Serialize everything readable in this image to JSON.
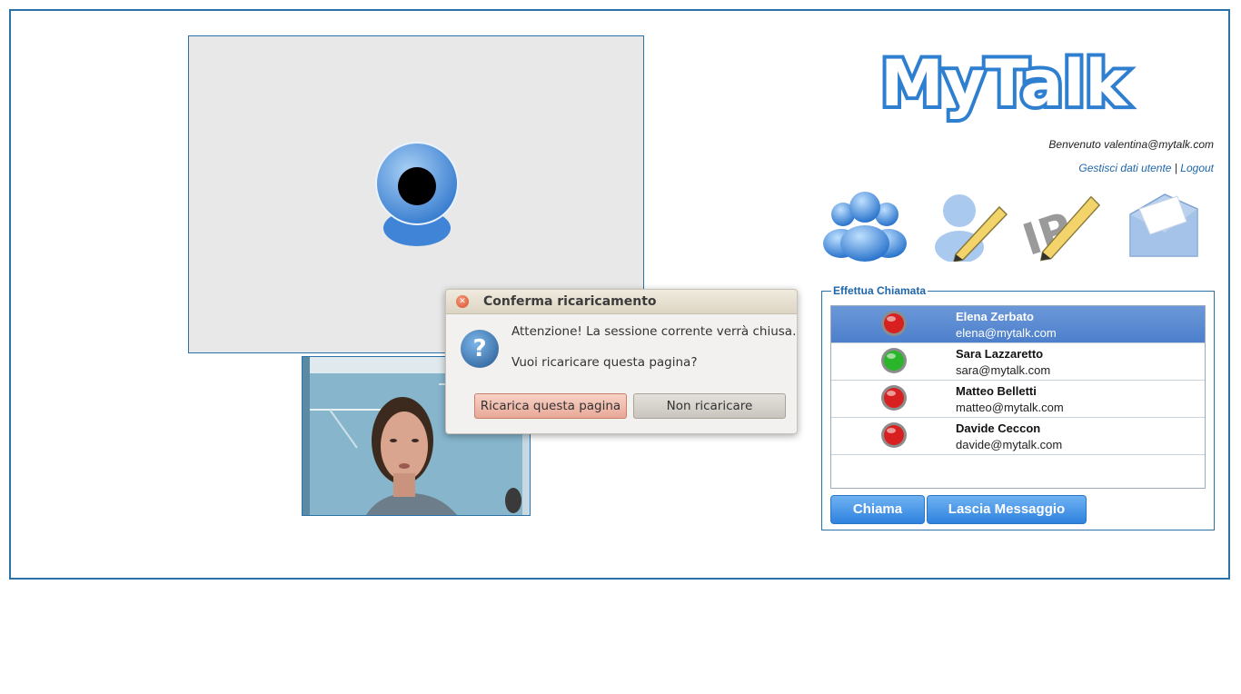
{
  "app": {
    "logo_text": "MyTalk",
    "welcome_text": "Benvenuto valentina@mytalk.com",
    "manage_user_link": "Gestisci dati utente",
    "separator": "|",
    "logout_link": "Logout"
  },
  "toolbar": {
    "icons": [
      "contacts-icon",
      "edit-user-icon",
      "edit-ip-icon",
      "messages-icon"
    ]
  },
  "call_panel": {
    "legend": "Effettua Chiamata",
    "contacts": [
      {
        "name": "Elena Zerbato",
        "email": "elena@mytalk.com",
        "status": "offline",
        "selected": true
      },
      {
        "name": "Sara Lazzaretto",
        "email": "sara@mytalk.com",
        "status": "online",
        "selected": false
      },
      {
        "name": "Matteo Belletti",
        "email": "matteo@mytalk.com",
        "status": "offline",
        "selected": false
      },
      {
        "name": "Davide Ceccon",
        "email": "davide@mytalk.com",
        "status": "offline",
        "selected": false
      }
    ],
    "call_button": "Chiama",
    "message_button": "Lascia Messaggio"
  },
  "dialog": {
    "title": "Conferma ricaricamento",
    "message_line1": "Attenzione! La sessione corrente verrà chiusa.",
    "message_line2": "Vuoi ricaricare questa pagina?",
    "reload_button": "Ricarica questa pagina",
    "cancel_button": "Non ricaricare"
  },
  "colors": {
    "accent": "#2a72a8",
    "link": "#1f66a8",
    "led_online": "#2bb52b",
    "led_offline": "#d82020"
  }
}
